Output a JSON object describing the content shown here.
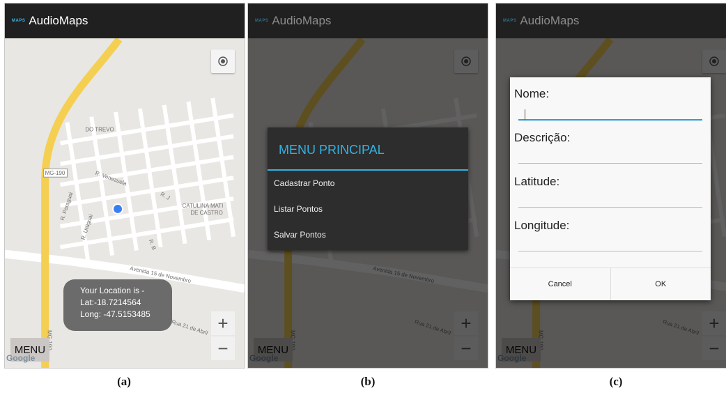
{
  "app": {
    "logo_text": "MAPS",
    "title": "AudioMaps"
  },
  "map_labels": {
    "road_mg190": "MG-190",
    "do_trevo": "DO TREVO",
    "r_venezuela": "R. Venezuela",
    "r_paraguai": "R. Paraguai",
    "r_uruguai": "R. Uruguai",
    "r_j": "R. J",
    "r_b": "R. B",
    "catulina": "CATULINA MATI",
    "de_castro": "DE CASTRO",
    "avenida_15": "Avenida 15 de Novembro",
    "rua_21": "Rua 21 de Abril",
    "mg190_vertical": "MG-190",
    "google": "Google"
  },
  "controls": {
    "menu_label": "MENU",
    "zoom_in": "+",
    "zoom_out": "−"
  },
  "toast": {
    "line1": "Your Location is -",
    "line2": "Lat:-18.7214564",
    "line3": "Long: -47.5153485"
  },
  "menu_dialog": {
    "title": "MENU PRINCIPAL",
    "items": [
      "Cadastrar Ponto",
      "Listar Pontos",
      "Salvar Pontos"
    ]
  },
  "form_dialog": {
    "fields": [
      "Nome:",
      "Descrição:",
      "Latitude:",
      "Longitude:"
    ],
    "cancel_label": "Cancel",
    "ok_label": "OK"
  },
  "captions": [
    "(a)",
    "(b)",
    "(c)"
  ],
  "colors": {
    "accent": "#34b0e0",
    "appbar": "#202020",
    "map_background": "#e9e7e3",
    "highway": "#f5cf52",
    "location_dot": "#3a7ff0"
  }
}
